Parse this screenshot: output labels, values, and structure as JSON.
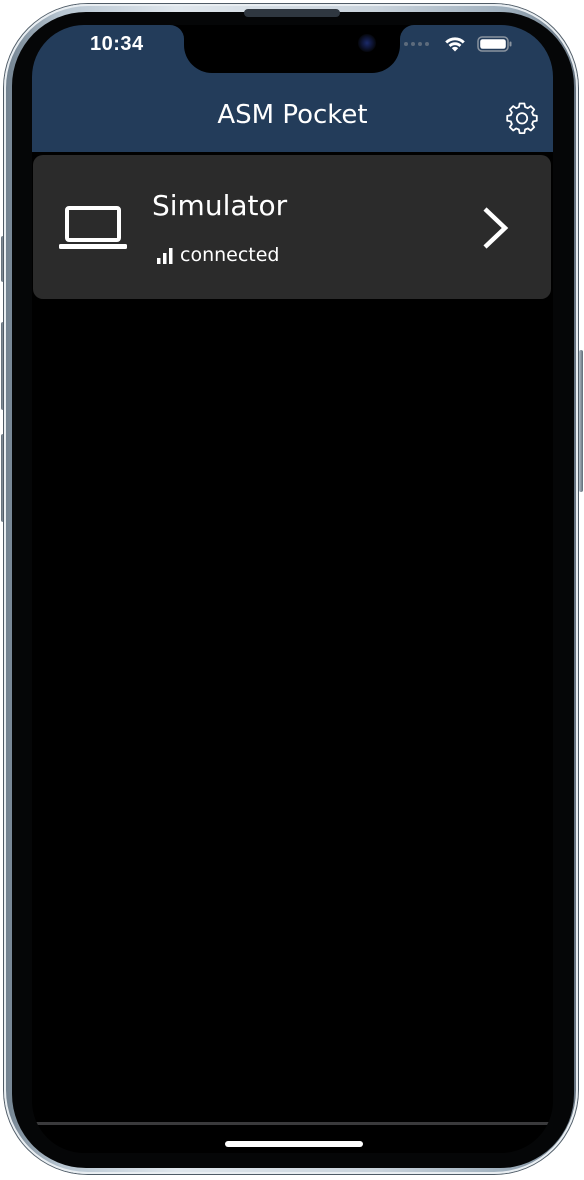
{
  "status_bar": {
    "time": "10:34",
    "icons": [
      "cellular-dots-icon",
      "wifi-icon",
      "battery-icon"
    ]
  },
  "header": {
    "title": "ASM Pocket",
    "settings_icon": "gear-icon",
    "background_color": "#233c5a"
  },
  "devices": [
    {
      "name": "Simulator",
      "status": "connected",
      "device_icon": "laptop-icon",
      "status_icon": "signal-bars-icon",
      "action_icon": "chevron-right-icon"
    }
  ],
  "colors": {
    "screen_background": "#000000",
    "row_background": "#2b2b2b",
    "text": "#ffffff"
  }
}
